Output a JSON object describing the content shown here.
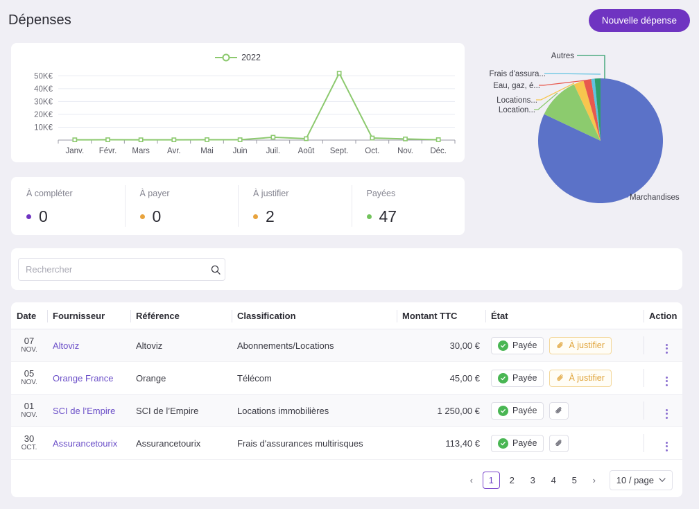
{
  "header": {
    "title": "Dépenses",
    "new_expense_label": "Nouvelle dépense"
  },
  "colors": {
    "brand_purple": "#6f34c1",
    "link_purple": "#6b4fc8",
    "line_green": "#8cc96e",
    "status_green": "#49b653",
    "status_orange": "#e8a33d",
    "status_purple": "#6f34c1",
    "warn_amber": "#e0a43a"
  },
  "chart_data": [
    {
      "type": "line",
      "title": "",
      "legend": [
        "2022"
      ],
      "legend_position": "top-center",
      "categories": [
        "Janv.",
        "Févr.",
        "Mars",
        "Avr.",
        "Mai",
        "Juin",
        "Juil.",
        "Août",
        "Sept.",
        "Oct.",
        "Nov.",
        "Déc."
      ],
      "series": [
        {
          "name": "2022",
          "color": "#8cc96e",
          "values": [
            200,
            250,
            200,
            200,
            300,
            250,
            2200,
            1100,
            52000,
            1600,
            900,
            300
          ]
        }
      ],
      "ytick_labels": [
        "10K€",
        "20K€",
        "30K€",
        "40K€",
        "50K€"
      ],
      "ytick_values": [
        10000,
        20000,
        30000,
        40000,
        50000
      ],
      "ylim": [
        0,
        55000
      ],
      "xlabel": "",
      "ylabel": "",
      "grid": true
    },
    {
      "type": "pie",
      "title": "",
      "labels": [
        "Marchandises",
        "Location...",
        "Locations...",
        "Eau, gaz, é...",
        "Frais d'assura...",
        "Autres"
      ],
      "values": [
        82.0,
        11.0,
        2.6,
        2.0,
        0.9,
        1.5
      ],
      "colors": [
        "#5b72c8",
        "#8ccb6e",
        "#f7c64e",
        "#e8594e",
        "#5fc2e0",
        "#2e9e6b"
      ],
      "legend_position": "callout-labels"
    }
  ],
  "stats": [
    {
      "label": "À compléter",
      "value": "0",
      "dot_color": "#6f34c1"
    },
    {
      "label": "À payer",
      "value": "0",
      "dot_color": "#e8a33d"
    },
    {
      "label": "À justifier",
      "value": "2",
      "dot_color": "#e8a33d"
    },
    {
      "label": "Payées",
      "value": "47",
      "dot_color": "#72c35c"
    }
  ],
  "search": {
    "placeholder": "Rechercher",
    "value": ""
  },
  "table": {
    "columns": [
      "Date",
      "Fournisseur",
      "Référence",
      "Classification",
      "Montant TTC",
      "État",
      "Action"
    ],
    "rows": [
      {
        "day": "07",
        "month": "NOV.",
        "supplier": "Altoviz",
        "reference": "Altoviz",
        "classification": "Abonnements/Locations",
        "amount": "30,00 €",
        "paid_label": "Payée",
        "justify_label": "À justifier",
        "has_justify_badge": true
      },
      {
        "day": "05",
        "month": "NOV.",
        "supplier": "Orange France",
        "reference": "Orange",
        "classification": "Télécom",
        "amount": "45,00 €",
        "paid_label": "Payée",
        "justify_label": "À justifier",
        "has_justify_badge": true
      },
      {
        "day": "01",
        "month": "NOV.",
        "supplier": "SCI de l’Empire",
        "reference": "SCI de l’Empire",
        "classification": "Locations immobilières",
        "amount": "1 250,00 €",
        "paid_label": "Payée",
        "justify_label": "",
        "has_justify_badge": false
      },
      {
        "day": "30",
        "month": "OCT.",
        "supplier": "Assurancetourix",
        "reference": "Assurancetourix",
        "classification": "Frais d'assurances multirisques",
        "amount": "113,40 €",
        "paid_label": "Payée",
        "justify_label": "",
        "has_justify_badge": false
      }
    ]
  },
  "pagination": {
    "prev": "‹",
    "next": "›",
    "pages": [
      "1",
      "2",
      "3",
      "4",
      "5"
    ],
    "current": "1",
    "page_size_label": "10 / page"
  }
}
